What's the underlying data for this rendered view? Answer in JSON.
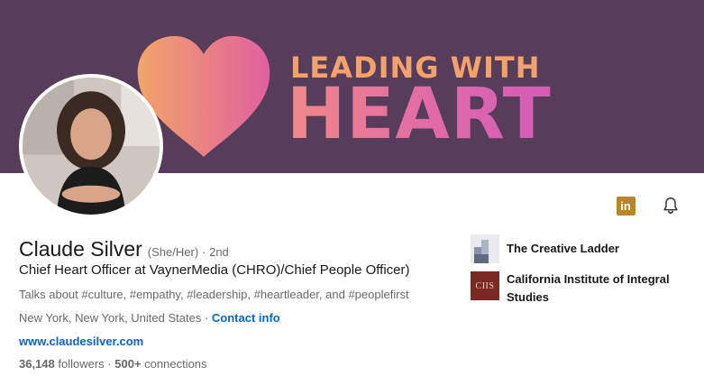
{
  "banner": {
    "line1": "LEADING WITH",
    "line2": "HEART",
    "bg_color": "#583c5c"
  },
  "profile": {
    "name": "Claude Silver",
    "pronouns": "(She/Her)",
    "degree": "· 2nd",
    "headline": "Chief Heart Officer at VaynerMedia (CHRO)/Chief People Officer)",
    "talks_about": "Talks about #culture, #empathy, #leadership, #heartleader, and #peoplefirst",
    "location": "New York, New York, United States",
    "separator": " · ",
    "contact_label": "Contact info",
    "website": "www.claudesilver.com",
    "followers_count": "36,148",
    "followers_label": " followers",
    "connections_sep": " · ",
    "connections_count": "500+",
    "connections_label": " connections"
  },
  "actions": {
    "linkedin_icon": "linkedin-icon",
    "linkedin_glyph": "in",
    "bell_icon": "bell-icon"
  },
  "orgs": [
    {
      "name": "The Creative Ladder",
      "logo": "creative-ladder-logo"
    },
    {
      "name": "California Institute of Integral Studies",
      "logo": "ciis-logo",
      "logo_text": "CIIS"
    }
  ],
  "colors": {
    "link": "#0a66c2",
    "linkedin_badge": "#b8862a",
    "ciis": "#7a2a23"
  }
}
